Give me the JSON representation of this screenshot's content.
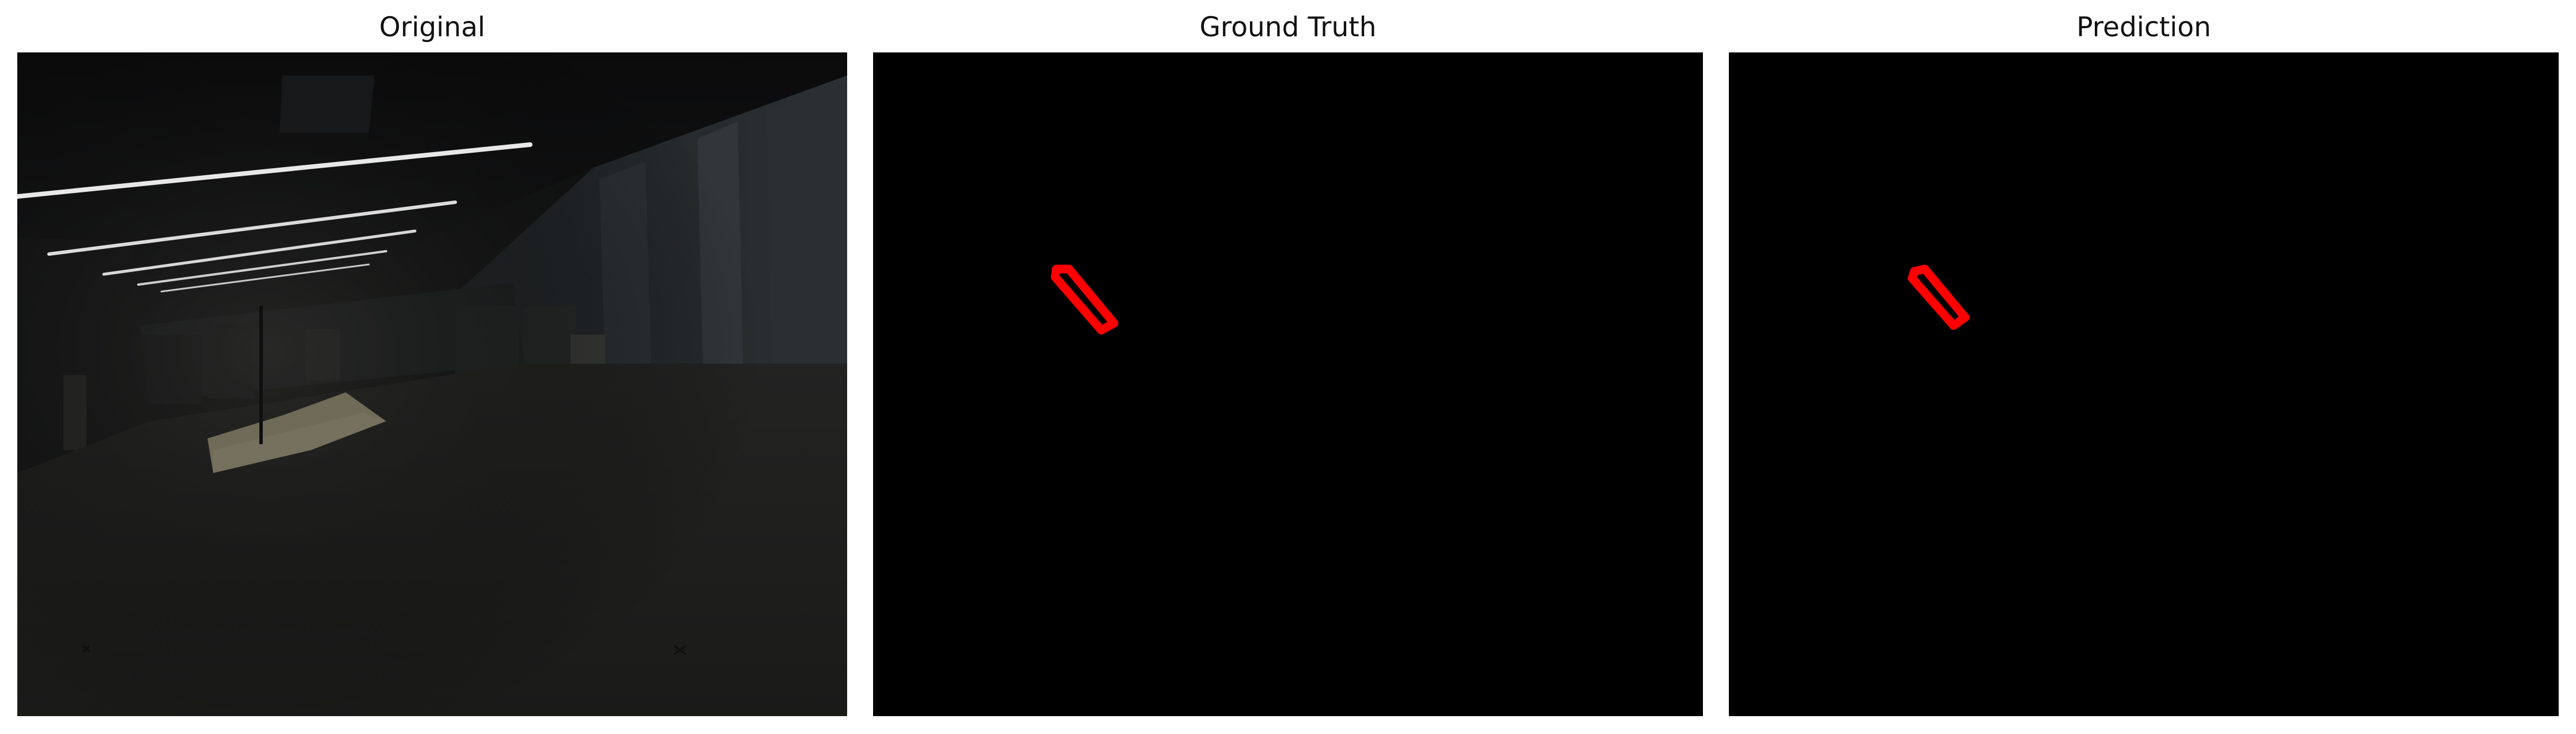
{
  "panels": [
    {
      "title": "Original"
    },
    {
      "title": "Ground Truth"
    },
    {
      "title": "Prediction"
    }
  ],
  "colors": {
    "mask_background": "#000000",
    "mask_outline": "#ff0000"
  }
}
